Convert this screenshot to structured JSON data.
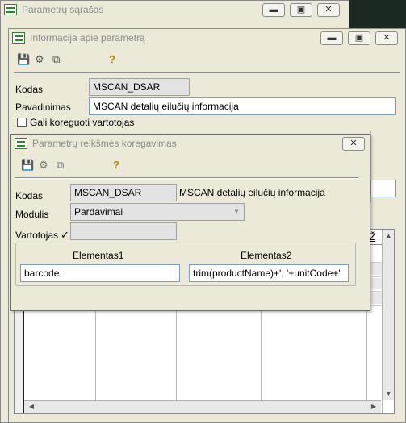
{
  "main_window": {
    "title": "Parametrų sąrašas"
  },
  "info_window": {
    "title": "Informacija apie parametrą",
    "kodas_label": "Kodas",
    "kodas_value": "MSCAN_DSAR",
    "pavadinimas_label": "Pavadinimas",
    "pavadinimas_value": "MSCAN detalių eilučių informacija",
    "checkbox_label": "Gali koreguoti vartotojas"
  },
  "edit_window": {
    "title": "Parametrų reikšmės koregavimas",
    "kodas_label": "Kodas",
    "kodas_value": "MSCAN_DSAR",
    "kodas_description": "MSCAN detalių eilučių informacija",
    "modulis_label": "Modulis",
    "modulis_value": "Pardavimai",
    "vartotojas_label": "Vartotojas",
    "elementas1_label": "Elementas1",
    "elementas1_value": "barcode",
    "elementas2_label": "Elementas2",
    "elementas2_value": "trim(productName)+', '+unitCode+'"
  },
  "grid": {
    "header_partial": "Ž"
  },
  "icons": {
    "save": "floppy-disk-icon",
    "tree": "tree-icon",
    "copy": "copy-icon",
    "help": "question-mark-icon"
  }
}
